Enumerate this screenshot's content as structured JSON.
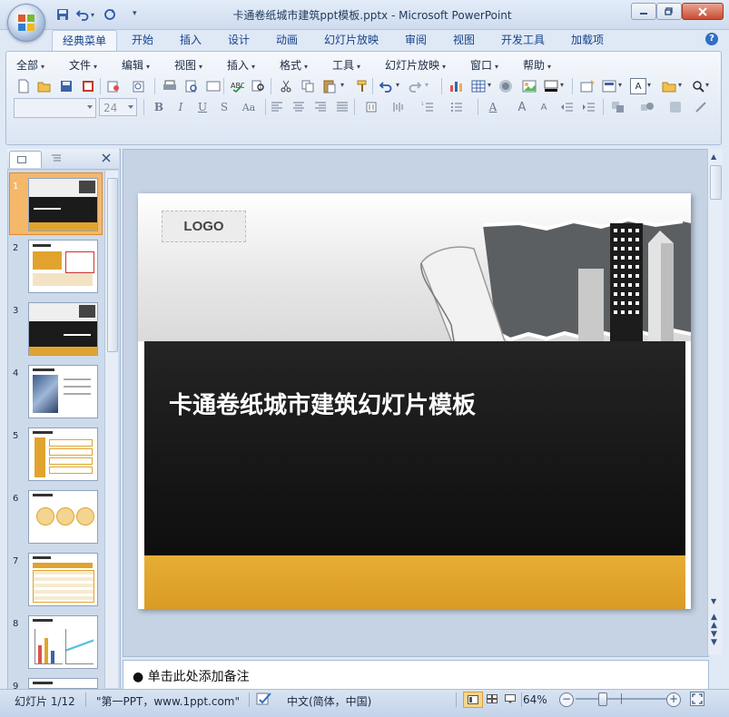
{
  "window": {
    "title": "卡通卷纸城市建筑ppt模板.pptx - Microsoft PowerPoint"
  },
  "ribbon_tabs": [
    "经典菜单",
    "开始",
    "插入",
    "设计",
    "动画",
    "幻灯片放映",
    "审阅",
    "视图",
    "开发工具",
    "加载项"
  ],
  "menus": [
    "全部",
    "文件",
    "编辑",
    "视图",
    "插入",
    "格式",
    "工具",
    "幻灯片放映",
    "窗口",
    "帮助"
  ],
  "formatting": {
    "font_size": "24"
  },
  "thumbnails": {
    "numbers": [
      "1",
      "2",
      "3",
      "4",
      "5",
      "6",
      "7",
      "8",
      "9"
    ]
  },
  "slide": {
    "logo": "LOGO",
    "title": "卡通卷纸城市建筑幻灯片模板",
    "colors": {
      "dark_band": "#1b1b1b",
      "accent": "#e0a42e"
    }
  },
  "notes": {
    "placeholder": "单击此处添加备注"
  },
  "status": {
    "slide_indicator": "幻灯片 1/12",
    "theme": "\"第一PPT，www.1ppt.com\"",
    "language": "中文(简体，中国)",
    "zoom": "64%"
  }
}
